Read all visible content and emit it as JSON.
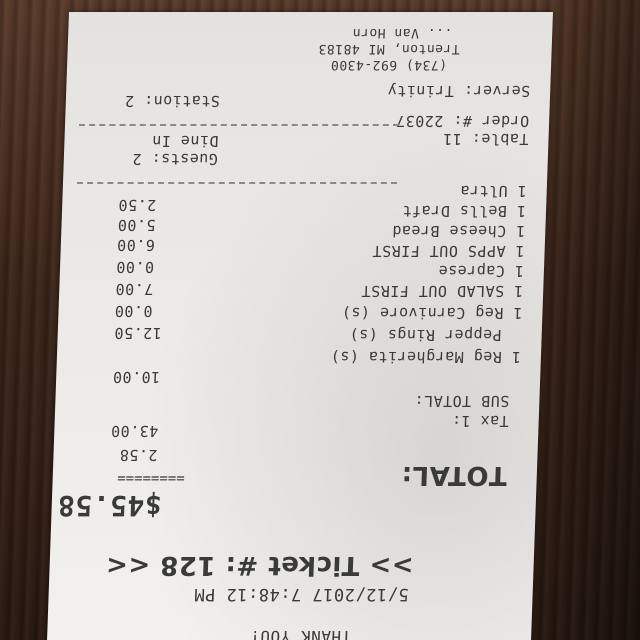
{
  "receipt": {
    "address_1": "... Van Horn",
    "address_2": "Trenton, MI 48183",
    "phone": "(734) 692-4300",
    "server": "Server: Trinity",
    "station": "Station: 2",
    "order": "Order #: 22037",
    "table": "Table: 11",
    "dine": "Dine In",
    "guests": "Guests: 2",
    "items": [
      {
        "label": "1 Ultra",
        "price": "2.50"
      },
      {
        "label": "1 Bells Draft",
        "price": "5.00"
      },
      {
        "label": "1 Cheese Bread",
        "price": "6.00"
      },
      {
        "label": "1 APPS OUT FIRST",
        "price": "0.00"
      },
      {
        "label": "1 Caprese",
        "price": "7.00"
      },
      {
        "label": "1 SALAD OUT FIRST",
        "price": "0.00"
      },
      {
        "label": "1 Reg Carnivore (s)",
        "price": "12.50"
      },
      {
        "label": "Pepper Rings (s)",
        "price": ""
      },
      {
        "label": "1 Reg Margherita (s)",
        "price": "10.00"
      }
    ],
    "subtotal_label": "SUB TOTAL:",
    "subtotal": "43.00",
    "tax_label": "Tax 1:",
    "tax": "2.58",
    "separator": "========",
    "total_label": "TOTAL:",
    "total": "$45.58",
    "ticket": ">> Ticket #: 128 <<",
    "datetime": "5/12/2017 7:48:12 PM",
    "footer": "THANK YOU!"
  }
}
